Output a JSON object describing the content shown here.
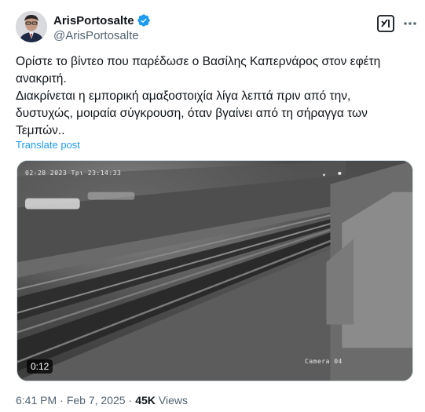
{
  "author": {
    "display_name": "ArisPortosalte",
    "handle": "@ArisPortosalte",
    "avatar_icon": "person-portrait",
    "verified_icon": "verified-badge-icon",
    "verified_color": "#1d9bf0"
  },
  "actions": {
    "grok_icon": "grok-icon",
    "more_icon": "more-horizontal-icon"
  },
  "tweet": {
    "line1": "Ορίστε το βίντεο που παρέδωσε ο Βασίλης Καπερνάρος στον εφέτη ανακριτή.",
    "line2": "Διακρίνεται η εμπορική αμαξοστοιχία λίγα λεπτά πριν από την, δυστυχώς, μοιραία σύγκρουση, όταν βγαίνει από τη σήραγγα των Τεμπών..",
    "translate_label": "Translate post"
  },
  "media": {
    "osd_timestamp": "02-28 2023 Tρι 23:14:33",
    "osd_camera": "Camera 04",
    "duration": "0:12"
  },
  "meta": {
    "time": "6:41 PM",
    "separator": "·",
    "date": "Feb 7, 2025",
    "views_count": "45K",
    "views_label": "Views"
  },
  "colors": {
    "link": "#1d9bf0",
    "secondary_text": "#536471",
    "primary_text": "#0f1419"
  }
}
